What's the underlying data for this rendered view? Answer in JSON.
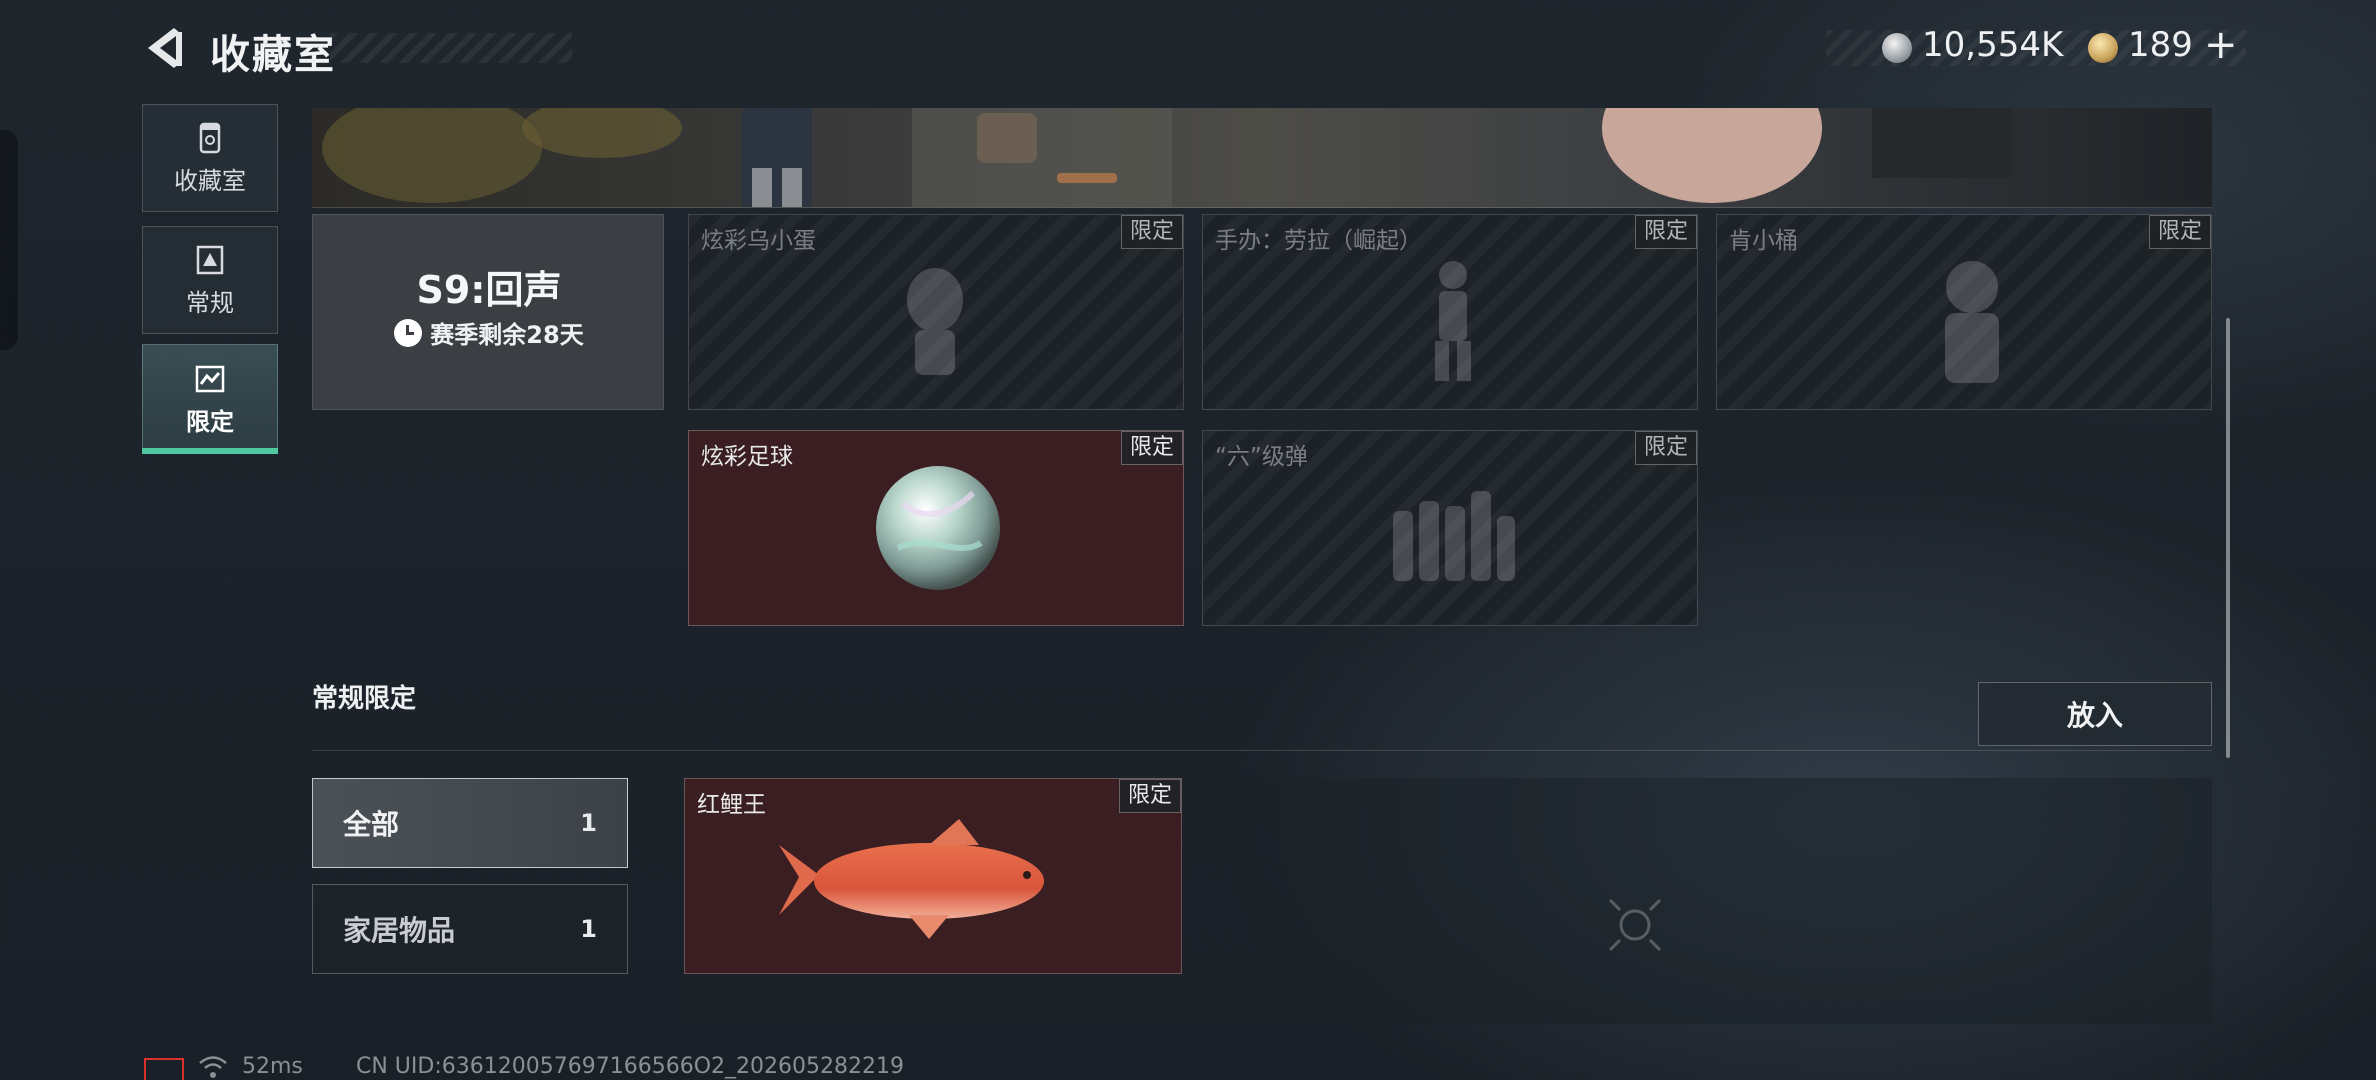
{
  "header": {
    "title": "收藏室",
    "currencies": [
      {
        "icon": "silver-coin-icon",
        "value": "10,554K"
      },
      {
        "icon": "gold-coin-icon",
        "value": "189"
      }
    ],
    "add_label": "+"
  },
  "nav": {
    "items": [
      {
        "label": "收藏室",
        "icon": "collection-room-icon"
      },
      {
        "label": "常规",
        "icon": "regular-icon"
      },
      {
        "label": "限定",
        "icon": "limited-icon",
        "active": true
      }
    ]
  },
  "season": {
    "title": "S9:回声",
    "remaining": "赛季剩余28天"
  },
  "season_items": [
    {
      "name": "炫彩乌小蛋",
      "badge": "限定",
      "owned": false
    },
    {
      "name": "手办：劳拉（崛起）",
      "badge": "限定",
      "owned": false
    },
    {
      "name": "肯小桶",
      "badge": "限定",
      "owned": false
    },
    {
      "name": "炫彩足球",
      "badge": "限定",
      "owned": true
    },
    {
      "name": "“六”级弹",
      "badge": "限定",
      "owned": false
    }
  ],
  "section": {
    "title": "常规限定",
    "place_button": "放入",
    "filters": [
      {
        "label": "全部",
        "count": "1",
        "active": true
      },
      {
        "label": "家居物品",
        "count": "1",
        "active": false
      }
    ],
    "items": [
      {
        "name": "红鲤王",
        "badge": "限定",
        "owned": true
      }
    ]
  },
  "footer": {
    "ping": "52ms",
    "uid": "CN UID:636120057697166566O2_202605282219"
  },
  "colors": {
    "accent": "#4ec9a0",
    "owned_card_bg": "#3a1e22",
    "locked_card_bg": "#1d2227"
  }
}
